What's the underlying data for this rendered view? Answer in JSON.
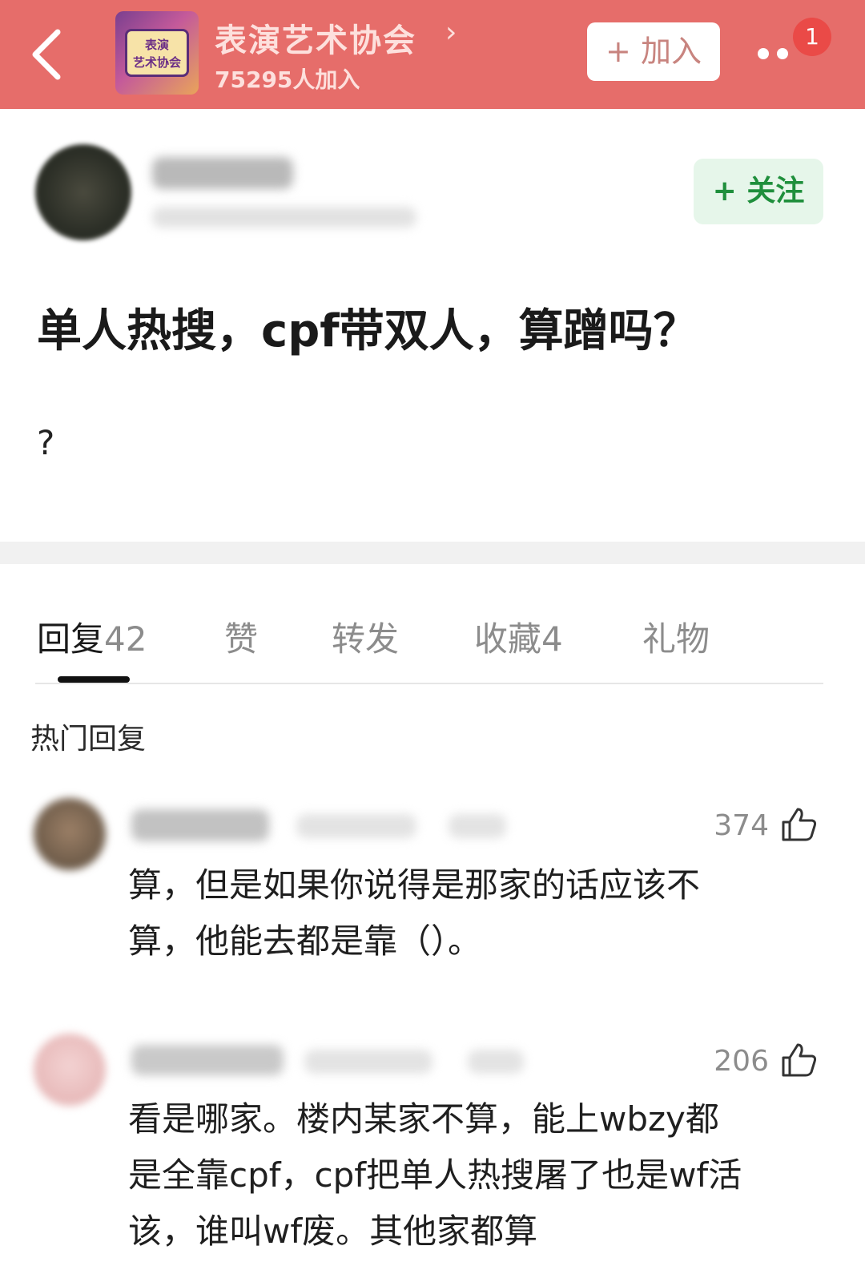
{
  "header": {
    "group_name": "表演艺术协会",
    "members": "75295人加入",
    "join_label": "+ 加入",
    "notification_count": "1",
    "avatar_text_1": "表演",
    "avatar_text_2": "艺术协会",
    "colors": {
      "bar": "#e66d6a",
      "badge": "#ea4a47"
    }
  },
  "post": {
    "follow_label": "+ 关注",
    "title": "单人热搜，cpf带双人，算蹭吗？",
    "body": "?"
  },
  "tabs": [
    {
      "label": "回复",
      "count": "42"
    },
    {
      "label": "赞",
      "count": ""
    },
    {
      "label": "转发",
      "count": ""
    },
    {
      "label": "收藏",
      "count": "4"
    },
    {
      "label": "礼物",
      "count": ""
    }
  ],
  "section_label": "热门回复",
  "replies": [
    {
      "likes": "374",
      "lines": [
        "算，但是如果你说得是那家的话应该不",
        "算，他能去都是靠（）。"
      ]
    },
    {
      "likes": "206",
      "lines": [
        "看是哪家。楼内某家不算，能上wbzy都",
        "是全靠cpf，cpf把单人热搜屠了也是wf活",
        "该，谁叫wf废。其他家都算"
      ]
    }
  ]
}
